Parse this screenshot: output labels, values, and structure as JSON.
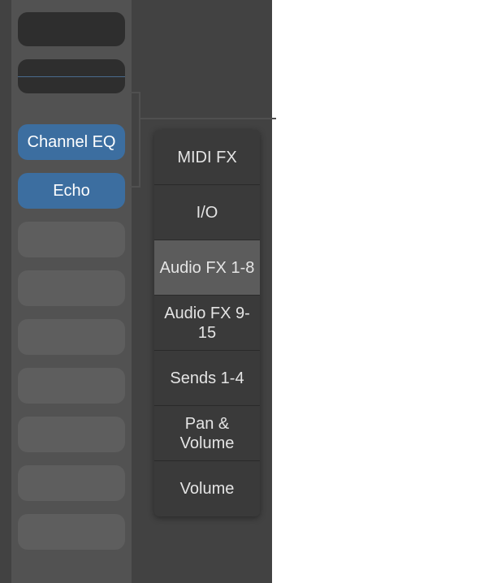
{
  "channelStrip": {
    "slots": [
      {
        "type": "dark",
        "label": ""
      },
      {
        "type": "dark-split",
        "label": ""
      },
      {
        "type": "active",
        "label": "Channel EQ"
      },
      {
        "type": "active",
        "label": "Echo"
      },
      {
        "type": "empty",
        "label": ""
      },
      {
        "type": "empty",
        "label": ""
      },
      {
        "type": "empty",
        "label": ""
      },
      {
        "type": "empty",
        "label": ""
      },
      {
        "type": "empty",
        "label": ""
      },
      {
        "type": "empty",
        "label": ""
      },
      {
        "type": "empty",
        "label": ""
      }
    ]
  },
  "menu": {
    "items": [
      {
        "label": "MIDI FX",
        "selected": false
      },
      {
        "label": "I/O",
        "selected": false
      },
      {
        "label": "Audio FX 1-8",
        "selected": true
      },
      {
        "label": "Audio FX 9-15",
        "selected": false
      },
      {
        "label": "Sends 1-4",
        "selected": false
      },
      {
        "label": "Pan & Volume",
        "selected": false
      },
      {
        "label": "Volume",
        "selected": false
      }
    ]
  }
}
